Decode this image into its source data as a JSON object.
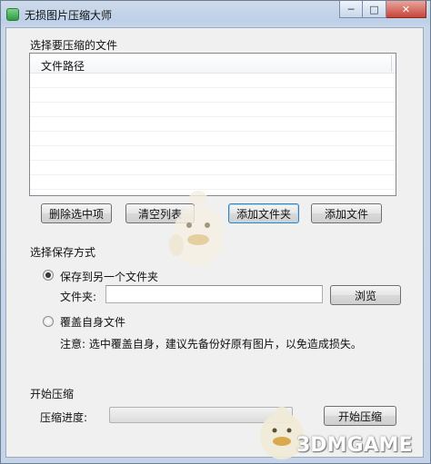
{
  "window": {
    "title": "无损图片压缩大师",
    "minimize_glyph": "─",
    "maximize_glyph": "□",
    "close_glyph": "✕"
  },
  "file_section": {
    "heading": "选择要压缩的文件",
    "column_header": "文件路径",
    "rows": []
  },
  "file_buttons": {
    "delete_selected": "删除选中项",
    "clear_list": "清空列表",
    "add_folder": "添加文件夹",
    "add_file": "添加文件"
  },
  "save_section": {
    "heading": "选择保存方式",
    "option_other_folder": "保存到另一个文件夹",
    "option_other_folder_checked": true,
    "folder_label": "文件夹:",
    "folder_value": "",
    "browse_label": "浏览",
    "option_overwrite": "覆盖自身文件",
    "option_overwrite_checked": false,
    "note": "注意: 选中覆盖自身，建议先备份好原有图片，以免造成损失。"
  },
  "compress_section": {
    "heading": "开始压缩",
    "progress_label": "压缩进度:",
    "progress_value": 0,
    "start_label": "开始压缩"
  },
  "watermark": {
    "logo_text": "3DMGAME"
  },
  "colors": {
    "title_gradient_top": "#cfdaea",
    "client_bg": "#f0f0f0",
    "focus_border": "#3c7fb1"
  }
}
